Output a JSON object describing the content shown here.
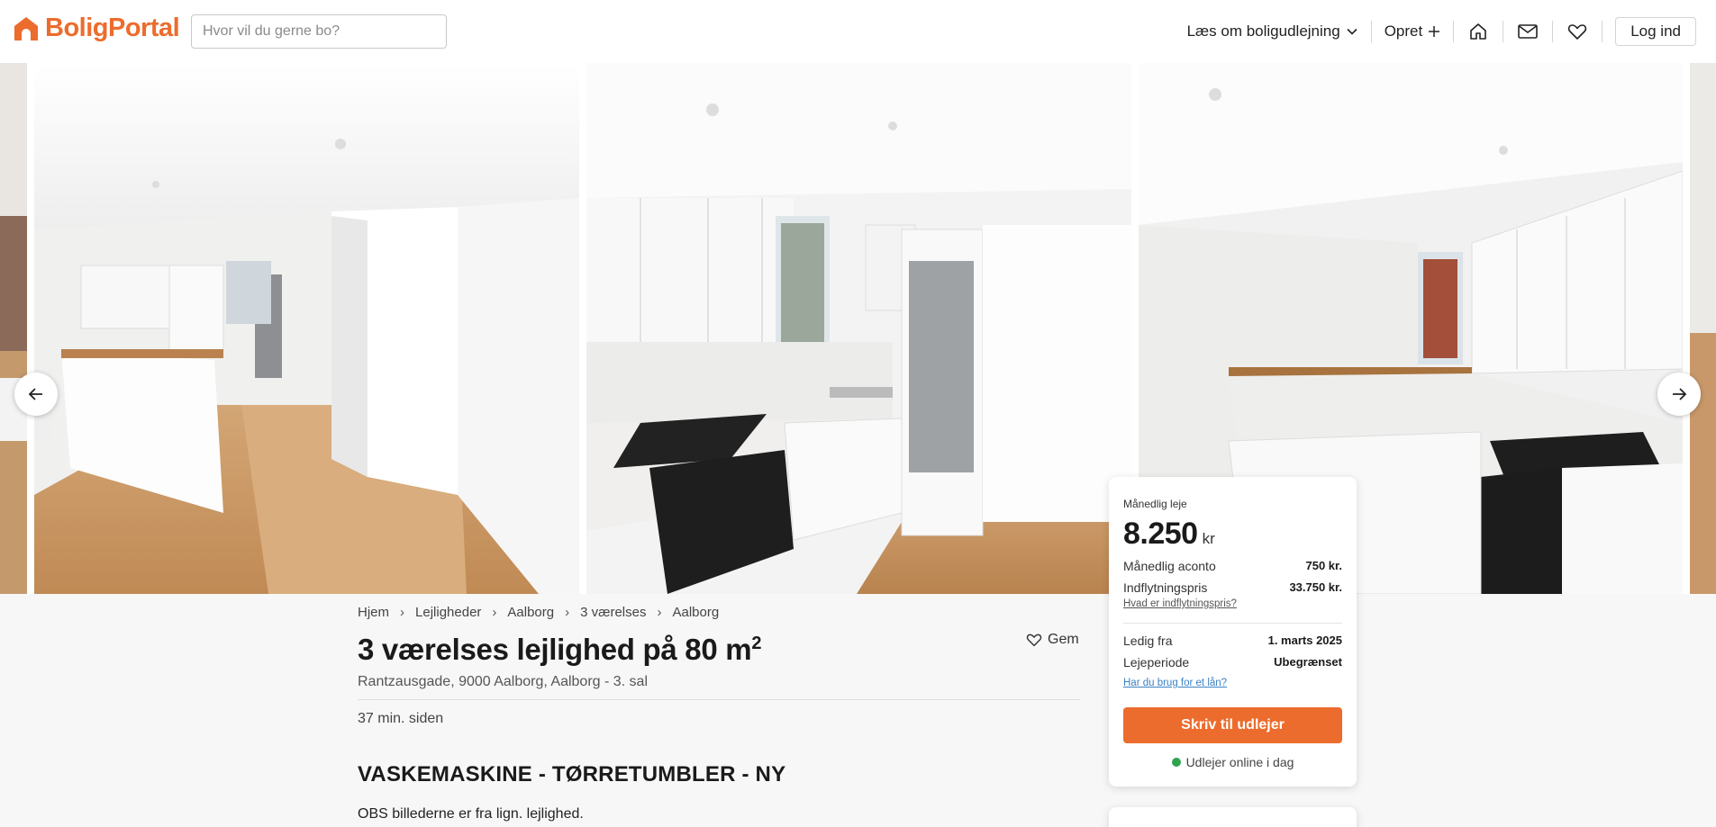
{
  "header": {
    "logo_text": "BoligPortal",
    "search_placeholder": "Hvor vil du gerne bo?",
    "nav": {
      "read_about": "Læs om boligudlejning",
      "create": "Opret",
      "login": "Log ind"
    },
    "brand_color": "#ec6c2d"
  },
  "gallery": {
    "photos": [
      "living-room-kitchen-photo",
      "kitchen-photo",
      "kitchen-corner-photo"
    ],
    "prev_icon": "arrow-left-icon",
    "next_icon": "arrow-right-icon"
  },
  "breadcrumb": [
    "Hjem",
    "Lejligheder",
    "Aalborg",
    "3 værelses",
    "Aalborg"
  ],
  "listing": {
    "title": "3 værelses lejlighed på 80 m",
    "title_sup": "2",
    "address": "Rantzausgade, 9000 Aalborg, Aalborg - 3. sal",
    "save_label": "Gem",
    "posted": "37 min. siden",
    "heading": "VASKEMASKINE - TØRRETUMBLER - NY",
    "description": "OBS billederne er fra lign. lejlighed."
  },
  "price_card": {
    "monthly_rent_label": "Månedlig leje",
    "monthly_rent_value": "8.250",
    "currency": "kr",
    "aconto_label": "Månedlig aconto",
    "aconto_value": "750 kr.",
    "movein_label": "Indflytningspris",
    "movein_value": "33.750 kr.",
    "movein_link": "Hvad er indflytningspris?",
    "available_label": "Ledig fra",
    "available_value": "1. marts 2025",
    "period_label": "Lejeperiode",
    "period_value": "Ubegrænset",
    "loan_link": "Har du brug for et lån?",
    "cta_label": "Skriv til udlejer",
    "online_status": "Udlejer online i dag",
    "online_color": "#2ea44f"
  }
}
